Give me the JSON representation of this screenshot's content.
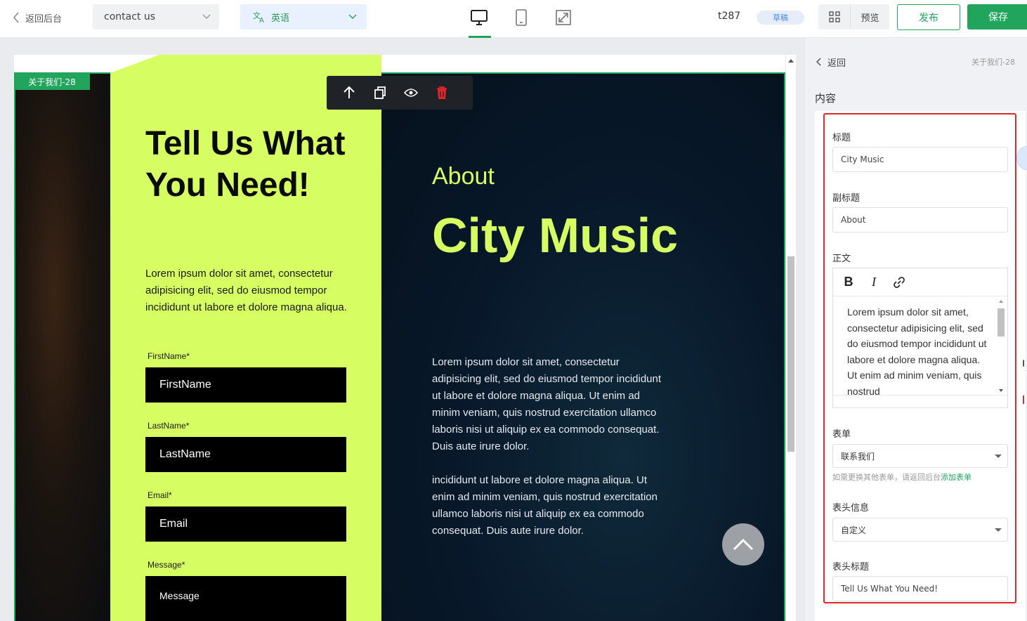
{
  "topbar": {
    "back_label": "返回后台",
    "page_select": "contact us",
    "language": "英语",
    "site_name": "t287",
    "status_badge": "草稿",
    "preview_label": "预览",
    "publish_label": "发布",
    "save_label": "保存"
  },
  "canvas": {
    "section_tag": "关于我们-28",
    "form_title": "Tell Us What You Need!",
    "form_description": "Lorem ipsum dolor sit amet, consectetur adipisicing elit, sed do eiusmod tempor incididunt ut labore et dolore magna aliqua.",
    "fields": [
      {
        "label": "FirstName",
        "required_mark": "*",
        "placeholder": "FirstName"
      },
      {
        "label": "LastName",
        "required_mark": "*",
        "placeholder": "LastName"
      },
      {
        "label": "Email",
        "required_mark": "*",
        "placeholder": "Email"
      },
      {
        "label": "Message",
        "required_mark": "*",
        "placeholder": "Message"
      }
    ],
    "about_subtitle": "About",
    "about_title": "City Music",
    "about_paragraphs": [
      "Lorem ipsum dolor sit amet, consectetur adipisicing elit, sed do eiusmod tempor incididunt ut labore et dolore magna aliqua. Ut enim ad minim veniam, quis nostrud exercitation ullamco laboris nisi ut aliquip ex ea commodo consequat. Duis aute irure dolor.",
      "incididunt ut labore et dolore magna aliqua. Ut enim ad minim veniam, quis nostrud exercitation ullamco laboris nisi ut aliquip ex ea commodo consequat. Duis aute irure dolor."
    ],
    "block_toolbar_icons": [
      "arrow-up-icon",
      "copy-icon",
      "eye-icon",
      "trash-icon"
    ]
  },
  "panel": {
    "back_label": "返回",
    "breadcrumb": "关于我们-28",
    "section_title": "内容",
    "title_label": "标题",
    "title_value": "City Music",
    "subtitle_label": "副标题",
    "subtitle_value": "About",
    "body_label": "正文",
    "body_value": "Lorem ipsum dolor sit amet, consectetur adipisicing elit, sed do eiusmod tempor incididunt ut labore et dolore magna aliqua. Ut enim ad minim veniam, quis nostrud",
    "form_label": "表单",
    "form_value": "联系我们",
    "hint_text": "如需更换其他表单，请返回后台",
    "hint_link": "添加表单",
    "header_info_label": "表头信息",
    "header_info_value": "自定义",
    "header_title_label": "表头标题",
    "header_title_value": "Tell Us What You Need!"
  },
  "colors": {
    "accent_green": "#21a45c",
    "lime": "#d6fd62",
    "highlight_red": "#e0262b"
  }
}
